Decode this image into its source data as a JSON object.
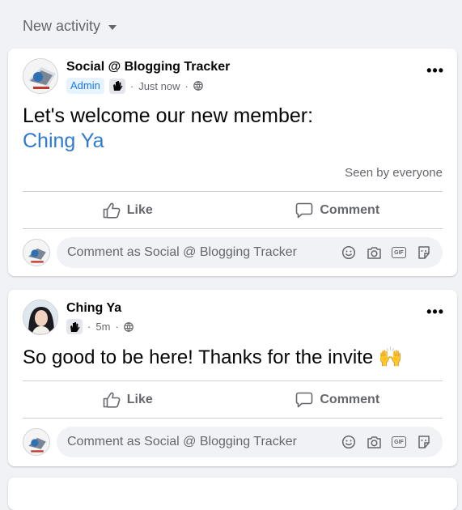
{
  "section": {
    "title": "New activity",
    "dropdown_icon": "caret-down-icon"
  },
  "posts": [
    {
      "author": "Social @ Blogging Tracker",
      "badge": "Admin",
      "time": "Just now",
      "separator": "·",
      "audience_icon": "globe-icon",
      "text_line1": "Let's welcome our new member:",
      "mention": "Ching Ya",
      "seen": "Seen by everyone",
      "like_label": "Like",
      "comment_label": "Comment",
      "comment_placeholder": "Comment as Social @ Blogging Tracker"
    },
    {
      "author": "Ching Ya",
      "time": "5m",
      "separator": "·",
      "audience_icon": "globe-icon",
      "text": "So good to be here! Thanks for the invite",
      "emoji": "🙌",
      "like_label": "Like",
      "comment_label": "Comment",
      "comment_placeholder": "Comment as Social @ Blogging Tracker"
    }
  ],
  "colors": {
    "background": "#f0f2f5",
    "accent": "#1877f2",
    "mention": "#2e7ad1",
    "muted": "#65676b"
  }
}
